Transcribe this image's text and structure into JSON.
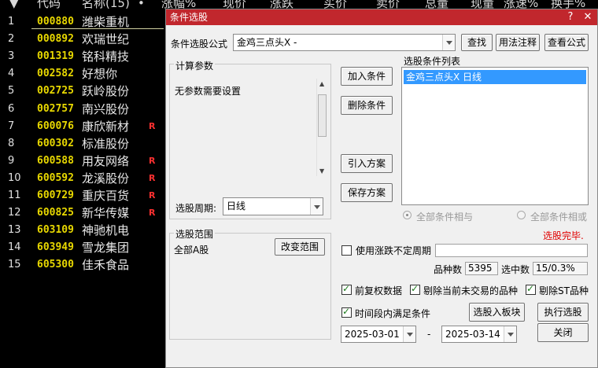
{
  "list": {
    "headers": [
      "代码",
      "名称(15)",
      "•",
      "涨幅%",
      "现价",
      "涨跌",
      "买价",
      "卖价",
      "总量",
      "现量",
      "涨速%",
      "换手%"
    ],
    "rows": [
      {
        "num": "1",
        "code": "000880",
        "name": "潍柴重机",
        "flag": ""
      },
      {
        "num": "2",
        "code": "000892",
        "name": "欢瑞世纪",
        "flag": ""
      },
      {
        "num": "3",
        "code": "001319",
        "name": "铭科精技",
        "flag": ""
      },
      {
        "num": "4",
        "code": "002582",
        "name": "好想你",
        "flag": ""
      },
      {
        "num": "5",
        "code": "002725",
        "name": "跃岭股份",
        "flag": ""
      },
      {
        "num": "6",
        "code": "002757",
        "name": "南兴股份",
        "flag": ""
      },
      {
        "num": "7",
        "code": "600076",
        "name": "康欣新材",
        "flag": "R"
      },
      {
        "num": "8",
        "code": "600302",
        "name": "标准股份",
        "flag": ""
      },
      {
        "num": "9",
        "code": "600588",
        "name": "用友网络",
        "flag": "R"
      },
      {
        "num": "10",
        "code": "600592",
        "name": "龙溪股份",
        "flag": "R"
      },
      {
        "num": "11",
        "code": "600729",
        "name": "重庆百货",
        "flag": "R"
      },
      {
        "num": "12",
        "code": "600825",
        "name": "新华传媒",
        "flag": "R"
      },
      {
        "num": "13",
        "code": "603109",
        "name": "神驰机电",
        "flag": ""
      },
      {
        "num": "14",
        "code": "603949",
        "name": "雪龙集团",
        "flag": ""
      },
      {
        "num": "15",
        "code": "605300",
        "name": "佳禾食品",
        "flag": ""
      }
    ]
  },
  "dialog": {
    "title": "条件选股",
    "controls": {
      "close": "✕"
    },
    "formula_label": "条件选股公式",
    "formula_value": "金鸡三点头X  -",
    "btn_find": "查找",
    "btn_usage": "用法注释",
    "btn_view": "查看公式",
    "params_title": "计算参数",
    "params_text": "无参数需要设置",
    "btn_add": "加入条件",
    "btn_delete": "删除条件",
    "btn_import": "引入方案",
    "btn_save": "保存方案",
    "cond_list_label": "选股条件列表",
    "cond_items": [
      "金鸡三点头X  日线"
    ],
    "period_label": "选股周期:",
    "period_value": "日线",
    "radio_and": "全部条件相与",
    "radio_or": "全部条件相或",
    "status": "选股完毕.",
    "range_title": "选股范围",
    "range_value": "全部A股",
    "btn_change_range": "改变范围",
    "chk_variable_period": "使用涨跌不定周期",
    "variable_period_value": "",
    "count_label": "品种数",
    "count_value": "5395",
    "selected_label": "选中数",
    "selected_value": "15/0.3%",
    "chk_prior_adjust": "前复权数据",
    "chk_exclude_untraded": "剔除当前未交易的品种",
    "chk_exclude_st": "剔除ST品种",
    "chk_time_range": "时间段内满足条件",
    "btn_select_to_board": "选股入板块",
    "btn_execute": "执行选股",
    "date_from": "2025-03-01",
    "date_sep": "-",
    "date_to": "2025-03-14",
    "btn_close": "关闭"
  }
}
